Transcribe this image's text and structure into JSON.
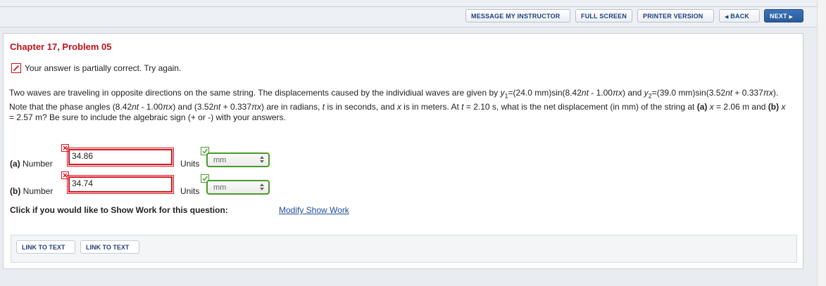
{
  "toolbar": {
    "message_instructor": "MESSAGE MY INSTRUCTOR",
    "full_screen": "FULL SCREEN",
    "printer_version": "PRINTER VERSION",
    "back": "BACK",
    "next": "NEXT"
  },
  "problem": {
    "chapter_title": "Chapter 17, Problem 05",
    "status_text": "Your answer is partially correct.  Try again.",
    "status_icon": "pencil-icon",
    "question": {
      "t1": "Two waves are traveling in opposite directions on the same string. The displacements caused by the individiual waves are given by ",
      "y": "y",
      "sub1": "1",
      "t2": "=(24.0 mm)sin(8.42",
      "nt": "nt",
      "t3": " - 1.00",
      "pi_x": "πx",
      "t4": ") and ",
      "sub2": "2",
      "t5": "=(39.0 mm)sin(3.52",
      "t6": " + 0.337",
      "t7": "). Note that the phase angles (8.42",
      "t8": ") and (3.52",
      "t9": ") are in radians, ",
      "t_var": "t",
      "t10": " is in seconds, and ",
      "x_var": "x",
      "t11": " is in meters. At ",
      "t12": " = 2.10 s, what is the net displacement (in mm) of the string at ",
      "a_label": "(a)",
      "t13": " = 2.06 m and ",
      "b_label": "(b)",
      "t14": " = 2.57 m? Be sure to include the algebraic sign (+ or -) with your answers."
    },
    "answers": [
      {
        "label_part": "(a)",
        "label_word": "Number",
        "value": "34.86",
        "number_mark": "incorrect",
        "units_label": "Units",
        "unit": "mm",
        "unit_mark": "correct"
      },
      {
        "label_part": "(b)",
        "label_word": "Number",
        "value": "34.74",
        "number_mark": "incorrect",
        "units_label": "Units",
        "unit": "mm",
        "unit_mark": "correct"
      }
    ],
    "show_work_prompt": "Click if you would like to Show Work for this question:",
    "modify_link": "Modify Show Work",
    "link_buttons": [
      "LINK TO TEXT",
      "LINK TO TEXT"
    ]
  },
  "colors": {
    "error_red": "#d4151e",
    "correct_green": "#4a9a2c",
    "link_blue": "#1f4d9a",
    "next_blue": "#2a5a9a"
  }
}
